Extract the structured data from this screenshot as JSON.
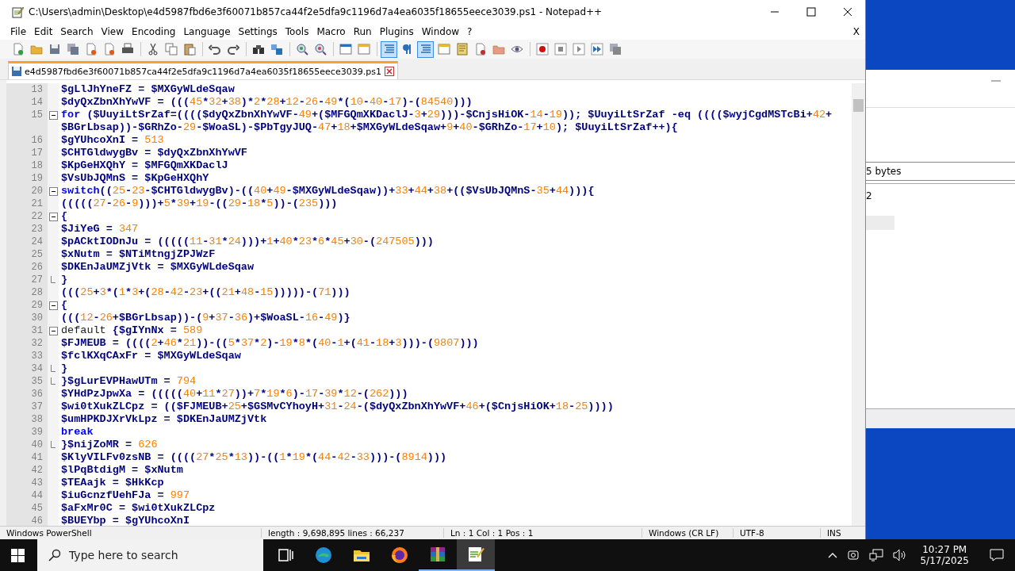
{
  "window": {
    "title": "C:\\Users\\admin\\Desktop\\e4d5987fbd6e3f60071b857ca44f2e5dfa9c1196d7a4ea6035f18655eece3039.ps1 - Notepad++"
  },
  "menu": [
    "File",
    "Edit",
    "Search",
    "View",
    "Encoding",
    "Language",
    "Settings",
    "Tools",
    "Macro",
    "Run",
    "Plugins",
    "Window",
    "?"
  ],
  "menu_close": "X",
  "toolbar": [
    {
      "kind": "new",
      "selected": false
    },
    {
      "kind": "open",
      "selected": false
    },
    {
      "kind": "save",
      "selected": false
    },
    {
      "kind": "save_all",
      "selected": false
    },
    {
      "kind": "close",
      "selected": false
    },
    {
      "kind": "close_all",
      "selected": false
    },
    {
      "kind": "print",
      "selected": false
    },
    {
      "kind": "separator"
    },
    {
      "kind": "cut",
      "selected": false
    },
    {
      "kind": "copy",
      "selected": false
    },
    {
      "kind": "paste",
      "selected": false
    },
    {
      "kind": "separator"
    },
    {
      "kind": "undo",
      "selected": false
    },
    {
      "kind": "redo",
      "selected": false
    },
    {
      "kind": "separator"
    },
    {
      "kind": "find",
      "selected": false
    },
    {
      "kind": "replace",
      "selected": false
    },
    {
      "kind": "separator"
    },
    {
      "kind": "zoom_in",
      "selected": false
    },
    {
      "kind": "zoom_out",
      "selected": false
    },
    {
      "kind": "separator"
    },
    {
      "kind": "sync_v",
      "selected": false
    },
    {
      "kind": "sync_h",
      "selected": false
    },
    {
      "kind": "separator"
    },
    {
      "kind": "wrap",
      "selected": true
    },
    {
      "kind": "all_chars",
      "selected": false
    },
    {
      "kind": "indent_guide",
      "selected": true
    },
    {
      "kind": "udl",
      "selected": false
    },
    {
      "kind": "doc_map",
      "selected": false
    },
    {
      "kind": "function_list",
      "selected": false
    },
    {
      "kind": "folder_workspace",
      "selected": false
    },
    {
      "kind": "monitor",
      "selected": false
    },
    {
      "kind": "separator"
    },
    {
      "kind": "record",
      "selected": false
    },
    {
      "kind": "stop",
      "selected": false
    },
    {
      "kind": "play",
      "selected": false
    },
    {
      "kind": "play_multi",
      "selected": false
    },
    {
      "kind": "save_macro",
      "selected": false
    }
  ],
  "tabs": [
    {
      "label": "e4d5987fbd6e3f60071b857ca44f2e5dfa9c1196d7a4ea6035f18655eece3039.ps1",
      "selected": true
    }
  ],
  "lines": [
    {
      "number": "13",
      "kind": "plain",
      "segments": [
        {
          "kind": "code",
          "text": "$gLlJhYneFZ = $MXGyWLdeSqaw"
        }
      ]
    },
    {
      "number": "14",
      "kind": "plain",
      "segments": [
        {
          "kind": "code",
          "text": "$dyQxZbnXhYwVF = (((45*32+38)*2*28+12-26-49*(10-40-17)-(84540)))"
        }
      ]
    },
    {
      "number": "15",
      "kind": "fold_start",
      "segments": [
        {
          "kind": "keyword",
          "text": "for"
        },
        {
          "kind": "code",
          "text": " ($UuyiLtSrZaf=(((($dyQxZbnXhYwVF-49+($MFGQmXKDaclJ-3+29)))-$CnjsHiOK-14-19)); $UuyiLtSrZaf -eq (((($wyjCgdMSTcBi+42+$BGrLbsap))-$GRhZo-29-$WoaSL)-$PbTgyJUQ-47+18+$MXGyWLdeSqaw+9+40-$GRhZo-17+10); $UuyiLtSrZaf++){"
        }
      ]
    },
    {
      "number": "16",
      "kind": "plain",
      "segments": [
        {
          "kind": "code",
          "text": "$gYUhcoXnI = 513"
        }
      ]
    },
    {
      "number": "17",
      "kind": "plain",
      "segments": [
        {
          "kind": "code",
          "text": "$CHTGldwygBv = $dyQxZbnXhYwVF"
        }
      ]
    },
    {
      "number": "18",
      "kind": "plain",
      "segments": [
        {
          "kind": "code",
          "text": "$KpGeHXQhY = $MFGQmXKDaclJ"
        }
      ]
    },
    {
      "number": "19",
      "kind": "plain",
      "segments": [
        {
          "kind": "code",
          "text": "$VsUbJQMnS = $KpGeHXQhY"
        }
      ]
    },
    {
      "number": "20",
      "kind": "fold_start",
      "segments": [
        {
          "kind": "keyword",
          "text": "switch"
        },
        {
          "kind": "code",
          "text": "((25-23-$CHTGldwygBv)-((40+49-$MXGyWLdeSqaw))+33+44+38+(($VsUbJQMnS-35+44))){"
        }
      ]
    },
    {
      "number": "21",
      "kind": "plain",
      "segments": [
        {
          "kind": "code",
          "text": "(((((27-26-9)))+5*39+19-((29-18*5))-(235)))"
        }
      ]
    },
    {
      "number": "22",
      "kind": "fold_start",
      "segments": [
        {
          "kind": "code",
          "text": "{"
        }
      ]
    },
    {
      "number": "23",
      "kind": "plain",
      "segments": [
        {
          "kind": "code",
          "text": "$JiYeG = 347"
        }
      ]
    },
    {
      "number": "24",
      "kind": "plain",
      "segments": [
        {
          "kind": "code",
          "text": "$pACktIODnJu = (((((11-31*24)))+1+40*23*6*45+30-(247505)))"
        }
      ]
    },
    {
      "number": "25",
      "kind": "plain",
      "segments": [
        {
          "kind": "code",
          "text": "$xNutm = $NTiMtngjZPJWzF"
        }
      ]
    },
    {
      "number": "26",
      "kind": "plain",
      "segments": [
        {
          "kind": "code",
          "text": "$DKEnJaUMZjVtk = $MXGyWLdeSqaw"
        }
      ]
    },
    {
      "number": "27",
      "kind": "fold_end",
      "segments": [
        {
          "kind": "code",
          "text": "}"
        }
      ]
    },
    {
      "number": "28",
      "kind": "plain",
      "segments": [
        {
          "kind": "code",
          "text": "(((25+3*(1*3+(28-42-23+((21+48-15)))))-(71)))"
        }
      ]
    },
    {
      "number": "29",
      "kind": "fold_start",
      "segments": [
        {
          "kind": "code",
          "text": "{"
        }
      ]
    },
    {
      "number": "30",
      "kind": "plain",
      "segments": [
        {
          "kind": "code",
          "text": "(((12-26+$BGrLbsap))-(9+37-36)+$WoaSL-16-49)}"
        }
      ]
    },
    {
      "number": "31",
      "kind": "fold_start",
      "segments": [
        {
          "kind": "plain",
          "text": "default"
        },
        {
          "kind": "code",
          "text": " {$gIYnNx = 589"
        }
      ]
    },
    {
      "number": "32",
      "kind": "plain",
      "segments": [
        {
          "kind": "code",
          "text": "$FJMEUB = ((((2+46*21))-((5*37*2)-19*8*(40-1+(41-18+3)))-(9807)))"
        }
      ]
    },
    {
      "number": "33",
      "kind": "plain",
      "segments": [
        {
          "kind": "code",
          "text": "$fclKXqCAxFr = $MXGyWLdeSqaw"
        }
      ]
    },
    {
      "number": "34",
      "kind": "fold_end",
      "segments": [
        {
          "kind": "code",
          "text": "}"
        }
      ]
    },
    {
      "number": "35",
      "kind": "fold_end",
      "segments": [
        {
          "kind": "code",
          "text": "}$gLurEVPHawUTm = 794"
        }
      ]
    },
    {
      "number": "36",
      "kind": "plain",
      "segments": [
        {
          "kind": "code",
          "text": "$YHdPzJpwXa = (((((40+11*27))+7*19*6)-17-39*12-(262)))"
        }
      ]
    },
    {
      "number": "37",
      "kind": "plain",
      "segments": [
        {
          "kind": "code",
          "text": "$wi0tXukZLCpz = (($FJMEUB+25+$GSMvCYhoyH+31-24-($dyQxZbnXhYwVF+46+($CnjsHiOK+18-25))))"
        }
      ]
    },
    {
      "number": "38",
      "kind": "plain",
      "segments": [
        {
          "kind": "code",
          "text": "$umHPKDJXrVkLpz = $DKEnJaUMZjVtk"
        }
      ]
    },
    {
      "number": "39",
      "kind": "plain",
      "segments": [
        {
          "kind": "keyword",
          "text": "break"
        }
      ]
    },
    {
      "number": "40",
      "kind": "fold_end",
      "segments": [
        {
          "kind": "code",
          "text": "}$nijZoMR = 626"
        }
      ]
    },
    {
      "number": "41",
      "kind": "plain",
      "segments": [
        {
          "kind": "code",
          "text": "$KlyVILFv0zsNB = ((((27*25*13))-((1*19*(44-42-33)))-(8914)))"
        }
      ]
    },
    {
      "number": "42",
      "kind": "plain",
      "segments": [
        {
          "kind": "code",
          "text": "$lPqBtdigM = $xNutm"
        }
      ]
    },
    {
      "number": "43",
      "kind": "plain",
      "segments": [
        {
          "kind": "code",
          "text": "$TEAajk = $HkKcp"
        }
      ]
    },
    {
      "number": "44",
      "kind": "plain",
      "segments": [
        {
          "kind": "code",
          "text": "$iuGcnzfUehFJa = 997"
        }
      ]
    },
    {
      "number": "45",
      "kind": "plain",
      "segments": [
        {
          "kind": "code",
          "text": "$aFxMr0C = $wi0tXukZLCpz"
        }
      ]
    },
    {
      "number": "46",
      "kind": "plain",
      "segments": [
        {
          "kind": "code",
          "text": "$BUEYbp = $gYUhcoXnI"
        }
      ]
    }
  ],
  "status_bar": [
    "Windows PowerShell",
    "length : 9,698,895    lines : 66,237",
    "Ln : 1    Col : 1    Pos : 1",
    "Windows (CR LF)",
    "UTF-8",
    "INS"
  ],
  "background_window": {
    "size_text": "5 bytes",
    "cell_text": "2"
  },
  "taskbar": {
    "search": {
      "placeholder": "Type here to search"
    },
    "apps": [
      {
        "kind": "task_view",
        "running": false,
        "selected": false
      },
      {
        "kind": "edge",
        "running": false,
        "selected": false
      },
      {
        "kind": "explorer",
        "running": false,
        "selected": false
      },
      {
        "kind": "firefox",
        "running": false,
        "selected": false
      },
      {
        "kind": "winrar",
        "running": true,
        "selected": false
      },
      {
        "kind": "notepad",
        "running": true,
        "selected": true
      }
    ],
    "time": "10:27 PM",
    "date": "5/17/2025"
  }
}
